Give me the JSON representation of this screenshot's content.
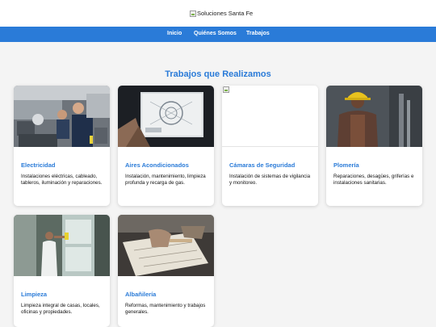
{
  "header": {
    "logo_alt": "Soluciones Santa Fe",
    "logo_icon": "broken-image-icon"
  },
  "nav": {
    "links": [
      "Inicio",
      "Quiénes Somos",
      "Trabajos"
    ]
  },
  "section": {
    "title": "Trabajos que Realizamos"
  },
  "cards": [
    {
      "title": "Electricidad",
      "description": "Instalaciones eléctricas, cableado, tableros, iluminación y reparaciones."
    },
    {
      "title": "Aires Acondicionados",
      "description": "Instalación, mantenimiento, limpieza profunda y recarga de gas."
    },
    {
      "title": "Cámaras de Seguridad",
      "description": "Instalación de sistemas de vigilancia y monitoreo."
    },
    {
      "title": "Plomería",
      "description": "Reparaciones, desagües, griferías e instalaciones sanitarias."
    },
    {
      "title": "Limpieza",
      "description": "Limpieza integral de casas, locales, oficinas y propiedades."
    },
    {
      "title": "Albañilería",
      "description": "Reformas, mantenimiento y trabajos generales."
    }
  ],
  "colors": {
    "accent": "#2a7bd8",
    "background": "#f4f4f4",
    "card": "#ffffff"
  }
}
